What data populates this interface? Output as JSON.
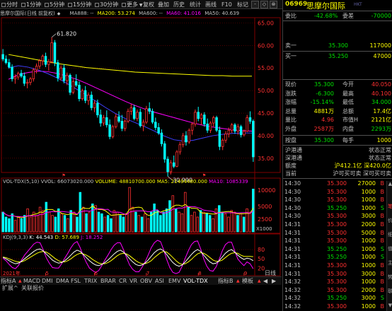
{
  "toolbar": {
    "periods": [
      {
        "label": "分时",
        "checked": false
      },
      {
        "label": "1分钟",
        "checked": false
      },
      {
        "label": "5分钟",
        "checked": false
      },
      {
        "label": "15分钟",
        "checked": false
      },
      {
        "label": "30分钟",
        "checked": false
      },
      {
        "label": "更多",
        "checked": false
      }
    ],
    "tools": [
      "复权",
      "叠加",
      "历史",
      "统计",
      "画线",
      "F10",
      "标记"
    ],
    "icons": [
      "-",
      "◇",
      "⊗"
    ]
  },
  "chart_header": {
    "name": "思摩尔国际(日线 前复权)",
    "ma888": "MA888: --",
    "ma200": "MA200: 53.274",
    "ma600": "MA600: --",
    "ma60": "MA60: 41.016",
    "ma50": "MA50: 40.639"
  },
  "colors": {
    "up": "#ff3030",
    "down": "#00ffff",
    "ma200": "#ffff00",
    "ma60": "#ff00ff",
    "ma50": "#4040ff",
    "grid": "#800000"
  },
  "chart_data": [
    {
      "type": "candlestick",
      "title": "思摩尔国际(日线 前复权)",
      "y_ticks": [
        65.0,
        60.0,
        55.0,
        50.0,
        45.0,
        40.0,
        35.0
      ],
      "ylim": [
        32.0,
        66.0
      ],
      "annotations": [
        {
          "label": "61.820",
          "value": 61.82
        },
        {
          "label": "30.990",
          "value": 30.99
        }
      ],
      "x_labels": [
        "2021年",
        "5",
        "6",
        "7",
        "8",
        "9"
      ],
      "candles": [
        [
          58.0,
          59.2,
          56.5,
          57.0
        ],
        [
          57.0,
          57.8,
          55.8,
          56.2
        ],
        [
          56.2,
          57.0,
          54.9,
          55.2
        ],
        [
          55.2,
          55.8,
          52.0,
          52.6
        ],
        [
          52.6,
          53.6,
          51.5,
          53.0
        ],
        [
          53.0,
          54.2,
          52.4,
          53.8
        ],
        [
          53.8,
          54.6,
          52.8,
          53.2
        ],
        [
          53.2,
          54.0,
          51.0,
          51.6
        ],
        [
          51.6,
          52.5,
          50.5,
          51.8
        ],
        [
          51.8,
          53.0,
          51.2,
          52.6
        ],
        [
          52.6,
          55.0,
          52.0,
          54.6
        ],
        [
          54.6,
          56.0,
          53.8,
          55.4
        ],
        [
          55.4,
          57.0,
          54.8,
          56.6
        ],
        [
          56.6,
          58.0,
          55.6,
          57.6
        ],
        [
          57.6,
          58.4,
          55.2,
          55.8
        ],
        [
          55.8,
          57.0,
          54.4,
          56.4
        ],
        [
          56.4,
          61.82,
          56.0,
          60.6
        ],
        [
          60.6,
          61.2,
          55.4,
          56.2
        ],
        [
          56.2,
          56.8,
          52.0,
          52.8
        ],
        [
          52.8,
          55.6,
          52.2,
          55.0
        ],
        [
          55.0,
          55.8,
          51.6,
          52.2
        ],
        [
          52.2,
          54.0,
          51.2,
          53.4
        ],
        [
          53.4,
          53.8,
          49.0,
          49.6
        ],
        [
          49.6,
          52.6,
          49.2,
          52.0
        ],
        [
          52.0,
          53.6,
          50.8,
          51.2
        ],
        [
          51.2,
          52.0,
          47.6,
          48.2
        ],
        [
          48.2,
          50.4,
          47.8,
          50.0
        ],
        [
          50.0,
          51.0,
          47.2,
          47.8
        ],
        [
          47.8,
          49.6,
          46.8,
          49.0
        ],
        [
          49.0,
          49.8,
          45.6,
          46.2
        ],
        [
          46.2,
          47.8,
          45.2,
          47.2
        ],
        [
          47.2,
          48.0,
          44.0,
          44.6
        ],
        [
          44.6,
          45.8,
          42.0,
          42.8
        ],
        [
          42.8,
          44.6,
          42.2,
          44.0
        ],
        [
          44.0,
          45.6,
          41.8,
          42.4
        ],
        [
          42.4,
          43.6,
          39.2,
          39.8
        ],
        [
          39.8,
          42.4,
          39.4,
          42.0
        ],
        [
          42.0,
          44.8,
          41.6,
          44.2
        ],
        [
          44.2,
          45.4,
          42.8,
          43.2
        ],
        [
          43.2,
          44.6,
          41.0,
          41.6
        ],
        [
          41.6,
          43.6,
          41.0,
          43.2
        ],
        [
          43.2,
          46.0,
          42.8,
          45.4
        ],
        [
          45.4,
          47.0,
          44.6,
          46.2
        ],
        [
          46.2,
          46.8,
          43.4,
          43.8
        ],
        [
          43.8,
          45.8,
          43.2,
          45.2
        ],
        [
          45.2,
          46.0,
          41.8,
          42.2
        ],
        [
          42.2,
          43.6,
          41.0,
          43.0
        ],
        [
          43.0,
          46.6,
          42.6,
          46.0
        ],
        [
          46.0,
          47.4,
          44.8,
          45.4
        ],
        [
          45.4,
          46.0,
          42.6,
          43.0
        ],
        [
          43.0,
          44.0,
          41.2,
          41.8
        ],
        [
          41.8,
          42.8,
          40.2,
          40.6
        ],
        [
          40.6,
          41.4,
          37.6,
          38.2
        ],
        [
          38.2,
          38.8,
          34.0,
          34.8
        ],
        [
          34.8,
          35.4,
          30.99,
          32.0
        ],
        [
          32.0,
          34.6,
          31.4,
          34.0
        ],
        [
          34.0,
          35.6,
          32.8,
          33.2
        ],
        [
          33.2,
          36.8,
          33.0,
          36.4
        ],
        [
          36.4,
          38.6,
          35.8,
          38.0
        ],
        [
          38.0,
          40.6,
          37.4,
          40.0
        ],
        [
          40.0,
          41.0,
          37.8,
          38.6
        ],
        [
          38.6,
          41.6,
          38.2,
          41.2
        ],
        [
          41.2,
          43.0,
          40.2,
          42.6
        ],
        [
          42.6,
          45.8,
          42.0,
          45.2
        ],
        [
          45.2,
          46.4,
          43.2,
          43.8
        ],
        [
          43.8,
          45.0,
          42.4,
          44.6
        ],
        [
          44.6,
          45.2,
          42.0,
          42.6
        ],
        [
          42.6,
          43.8,
          40.6,
          41.2
        ],
        [
          41.2,
          43.2,
          40.6,
          42.8
        ],
        [
          42.8,
          44.4,
          42.0,
          44.0
        ],
        [
          44.0,
          44.4,
          40.8,
          41.2
        ],
        [
          41.2,
          42.0,
          36.8,
          37.6
        ],
        [
          37.6,
          39.4,
          36.8,
          39.0
        ],
        [
          39.0,
          41.0,
          38.4,
          40.4
        ],
        [
          40.4,
          41.8,
          39.6,
          41.2
        ],
        [
          41.2,
          42.8,
          40.6,
          42.4
        ],
        [
          42.4,
          42.8,
          40.4,
          41.0
        ],
        [
          41.0,
          42.6,
          40.2,
          42.0
        ],
        [
          42.0,
          42.4,
          39.6,
          40.2
        ],
        [
          40.2,
          41.4,
          39.8,
          41.0
        ],
        [
          41.0,
          44.6,
          40.8,
          44.0
        ],
        [
          44.0,
          45.4,
          42.6,
          43.2
        ],
        [
          43.2,
          43.6,
          34.2,
          35.3
        ]
      ],
      "ma200": [
        58.0,
        57.6,
        57.2,
        56.8,
        56.4,
        56.0,
        55.7,
        55.4,
        55.1,
        54.9,
        54.7,
        54.5,
        54.3,
        54.1,
        54.0,
        53.9,
        53.8,
        53.7,
        53.6,
        53.5,
        53.4,
        53.3,
        53.3,
        53.2,
        53.2,
        53.2
      ],
      "ma60": [
        52.5,
        53.5,
        54.0,
        54.3,
        54.2,
        53.8,
        53.2,
        52.5,
        51.6,
        50.6,
        49.6,
        48.6,
        47.6,
        46.7,
        45.9,
        45.2,
        44.6,
        44.0,
        43.4,
        42.8,
        42.3,
        41.9,
        41.6,
        41.3,
        41.1,
        41.0
      ],
      "ma50": [
        55.0,
        55.5,
        55.2,
        54.6,
        53.8,
        52.8,
        51.6,
        50.3,
        49.0,
        47.6,
        46.2,
        44.9,
        43.8,
        42.9,
        42.0,
        41.0,
        39.9,
        39.1,
        38.8,
        39.0,
        39.5,
        40.0,
        40.3,
        40.5,
        40.6,
        40.6
      ]
    },
    {
      "type": "bar",
      "title": "VOL-TDX(5,10)",
      "legend": [
        {
          "label": "VVOL: 66073020.000",
          "color": "#c0c0c0"
        },
        {
          "label": "VOLUME: 48810700.000",
          "color": "#ffff00"
        },
        {
          "label": "MA5: 21494480.000",
          "color": "#ffff00"
        },
        {
          "label": "MA10: 1085339",
          "color": "#ff00ff"
        }
      ],
      "y_ticks": [
        "10000",
        "5000",
        "2500"
      ],
      "unit": "X1000",
      "values": [
        12,
        9,
        8,
        11,
        7,
        9,
        8,
        10,
        14,
        9,
        12,
        10,
        15,
        13,
        18,
        12,
        10,
        9,
        14,
        11,
        10,
        8,
        13,
        12,
        9,
        24,
        15,
        11,
        12,
        17,
        16,
        12,
        11,
        9,
        10,
        8,
        13,
        12,
        10,
        9,
        11,
        27,
        15,
        12,
        10,
        9,
        11,
        8,
        12,
        17,
        13,
        10,
        12,
        14,
        19,
        22,
        14,
        12,
        11,
        24,
        15,
        10,
        12,
        9,
        13,
        12,
        11,
        10,
        8,
        14,
        16,
        12,
        11,
        9,
        13,
        12,
        10,
        11,
        9,
        14,
        12,
        26
      ]
    },
    {
      "type": "line",
      "title": "KDJ(9,3,3)",
      "legend": [
        {
          "label": "K: 44.543",
          "color": "#ffffff"
        },
        {
          "label": "D: 57.689",
          "color": "#ffff00"
        },
        {
          "label": "J: 18.252",
          "color": "#ff00ff"
        }
      ],
      "y_ticks": [
        "80",
        "50",
        "20"
      ],
      "ylim": [
        0,
        110
      ],
      "K": [
        55,
        50,
        44,
        38,
        34,
        36,
        42,
        50,
        58,
        66,
        74,
        80,
        82,
        76,
        66,
        56,
        46,
        40,
        36,
        38,
        44,
        52,
        62,
        72,
        78,
        74,
        64,
        54,
        44,
        36,
        30,
        28,
        32,
        38,
        46,
        56,
        66,
        74,
        78,
        72,
        62,
        50,
        40,
        32,
        28,
        30,
        36,
        46,
        58,
        70,
        78,
        82,
        76,
        64,
        50,
        38,
        30,
        26,
        30,
        40,
        52,
        64,
        74,
        80,
        74,
        62,
        50,
        40,
        34,
        36,
        44,
        56,
        68,
        76,
        80,
        72,
        62,
        54,
        48,
        52,
        50,
        44
      ],
      "D": [
        56,
        54,
        50,
        46,
        42,
        40,
        40,
        44,
        50,
        56,
        62,
        68,
        72,
        74,
        72,
        66,
        58,
        50,
        44,
        40,
        40,
        44,
        50,
        58,
        64,
        68,
        66,
        62,
        56,
        48,
        42,
        36,
        34,
        34,
        38,
        44,
        52,
        60,
        66,
        68,
        66,
        60,
        52,
        44,
        38,
        34,
        34,
        38,
        44,
        54,
        62,
        70,
        74,
        72,
        64,
        54,
        44,
        36,
        32,
        34,
        40,
        48,
        58,
        66,
        70,
        68,
        62,
        54,
        46,
        42,
        42,
        46,
        54,
        62,
        68,
        70,
        68,
        62,
        58,
        58,
        58,
        57
      ],
      "J": [
        52,
        44,
        32,
        22,
        18,
        28,
        46,
        62,
        74,
        86,
        98,
        104,
        102,
        80,
        54,
        36,
        22,
        20,
        20,
        34,
        52,
        68,
        86,
        100,
        106,
        86,
        60,
        38,
        20,
        12,
        6,
        12,
        28,
        46,
        62,
        80,
        94,
        102,
        102,
        80,
        54,
        30,
        16,
        8,
        8,
        22,
        40,
        62,
        86,
        102,
        110,
        106,
        80,
        48,
        22,
        6,
        2,
        6,
        26,
        52,
        76,
        96,
        106,
        108,
        82,
        50,
        26,
        12,
        10,
        24,
        48,
        76,
        96,
        104,
        104,
        76,
        50,
        38,
        28,
        40,
        34,
        18
      ]
    }
  ],
  "bottom_tabs": [
    "指标A",
    "MACD",
    "DMI",
    "DMA",
    "FSL",
    "TRIX",
    "BRAR",
    "CR",
    "VR",
    "OBV",
    "ASI",
    "EMV",
    "VOL-TDX",
    "指标B",
    "模板"
  ],
  "status": {
    "left": "扩展^",
    "left2": "关联报价",
    "right_tab": "日线"
  },
  "quote": {
    "code": "06969",
    "name": "思摩尔国际",
    "ghost": "HKT",
    "weibi_label": "委比",
    "weibi": "-42.68%",
    "weicha_label": "委差",
    "weicha": "-70000",
    "sell_label": "卖一",
    "sell_price": "35.300",
    "sell_vol": "117000",
    "buy_label": "买一",
    "buy_price": "35.250",
    "buy_vol": "47000",
    "stats": [
      {
        "l1": "现价",
        "v1": "35.300",
        "c1": "green",
        "l2": "今开",
        "v2": "40.050",
        "c2": "red"
      },
      {
        "l1": "涨跌",
        "v1": "-6.300",
        "c1": "green",
        "l2": "最高",
        "v2": "40.100",
        "c2": "red"
      },
      {
        "l1": "涨幅",
        "v1": "-15.14%",
        "c1": "green",
        "l2": "最低",
        "v2": "34.000",
        "c2": "green"
      },
      {
        "l1": "总量",
        "v1": "4881万",
        "c1": "yellow",
        "l2": "总额",
        "v2": "17.4亿",
        "c2": "yellow"
      },
      {
        "l1": "量比",
        "v1": "4.96",
        "c1": "red",
        "l2": "市值H",
        "v2": "2121亿",
        "c2": "yellow"
      },
      {
        "l1": "外盘",
        "v1": "2587万",
        "c1": "red",
        "l2": "内盘",
        "v2": "2293万",
        "c2": "green"
      }
    ],
    "trade_row": {
      "l1": "按盘",
      "v1": "35.300",
      "l2": "每手",
      "v2": "1000"
    },
    "status_rows": [
      {
        "label": "沪港通",
        "value": "状态正常"
      },
      {
        "label": "深港通",
        "value": "状态正常"
      }
    ],
    "quota_label": "额度",
    "quota_value": "沪412.1亿 深420.0亿",
    "current_label": "当前",
    "current_value": "沪可买可卖 深可买可卖",
    "ticks": [
      {
        "t": "14:30",
        "p": "35.300",
        "v": "27000",
        "d": "B",
        "dc": "red"
      },
      {
        "t": "14:30",
        "p": "35.300",
        "v": "1000",
        "d": "B",
        "dc": "red"
      },
      {
        "t": "14:30",
        "p": "35.300",
        "v": "1000",
        "d": "B",
        "dc": "red"
      },
      {
        "t": "14:30",
        "p": "35.250",
        "v": "1000",
        "d": "S",
        "dc": "green"
      },
      {
        "t": "14:30",
        "p": "35.300",
        "v": "3000",
        "d": "B",
        "dc": "red"
      },
      {
        "t": "14:31",
        "p": "35.300",
        "v": "2000",
        "d": "B",
        "dc": "red"
      },
      {
        "t": "14:31",
        "p": "35.300",
        "v": "5000",
        "d": "B",
        "dc": "red"
      },
      {
        "t": "14:31",
        "p": "35.300",
        "v": "1000",
        "d": "B",
        "dc": "red"
      },
      {
        "t": "14:31",
        "p": "35.250",
        "v": "1000",
        "d": "S",
        "dc": "green"
      },
      {
        "t": "14:31",
        "p": "35.250",
        "v": "1000",
        "d": "S",
        "dc": "green"
      },
      {
        "t": "14:31",
        "p": "35.300",
        "v": "1000",
        "d": "B",
        "dc": "red"
      },
      {
        "t": "14:31",
        "p": "35.300",
        "v": "3000",
        "d": "B",
        "dc": "red"
      },
      {
        "t": "14:32",
        "p": "35.300",
        "v": "1000",
        "d": "B",
        "dc": "red"
      },
      {
        "t": "14:32",
        "p": "35.300",
        "v": "2000",
        "d": "B",
        "dc": "red"
      },
      {
        "t": "14:32",
        "p": "35.250",
        "v": "3000",
        "d": "S",
        "dc": "green"
      },
      {
        "t": "14:32",
        "p": "35.300",
        "v": "1000",
        "d": "B",
        "dc": "red"
      }
    ]
  }
}
